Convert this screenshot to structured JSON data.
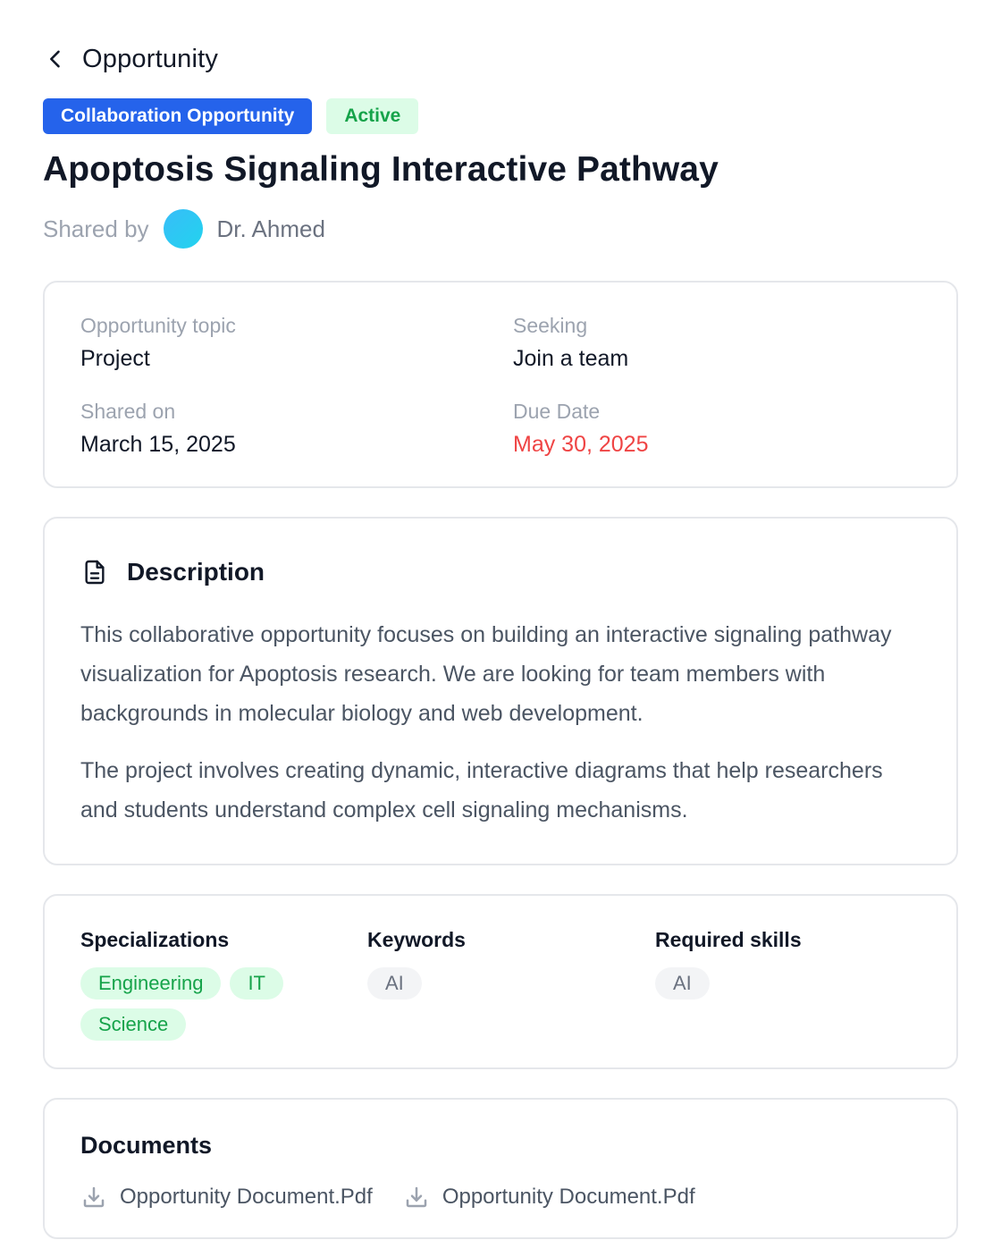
{
  "header": {
    "title": "Opportunity"
  },
  "badges": {
    "type": "Collaboration Opportunity",
    "status": "Active"
  },
  "title": "Apoptosis Signaling Interactive Pathway",
  "shared": {
    "label": "Shared by",
    "name": "Dr. Ahmed"
  },
  "info": {
    "topic_label": "Opportunity topic",
    "topic_value": "Project",
    "seeking_label": "Seeking",
    "seeking_value": "Join a team",
    "shared_on_label": "Shared on",
    "shared_on_value": "March 15, 2025",
    "due_label": "Due Date",
    "due_value": "May 30, 2025"
  },
  "description": {
    "title": "Description",
    "paragraphs": [
      "This collaborative opportunity focuses on building an interactive signaling pathway visualization for Apoptosis research. We are looking for team members with backgrounds in molecular biology and web development.",
      "The project involves creating dynamic, interactive diagrams that help researchers and students understand complex cell signaling mechanisms."
    ]
  },
  "tags": {
    "specializations_title": "Specializations",
    "specializations": [
      "Engineering",
      "IT",
      "Science"
    ],
    "keywords_title": "Keywords",
    "keywords": [
      "AI"
    ],
    "skills_title": "Required skills",
    "skills": [
      "AI"
    ]
  },
  "documents": {
    "title": "Documents",
    "files": [
      "Opportunity Document.Pdf",
      "Opportunity Document.Pdf"
    ]
  },
  "colors": {
    "primary": "#2563eb",
    "success": "#16a34a",
    "success_bg": "#dcfce7",
    "danger": "#ef4444"
  }
}
